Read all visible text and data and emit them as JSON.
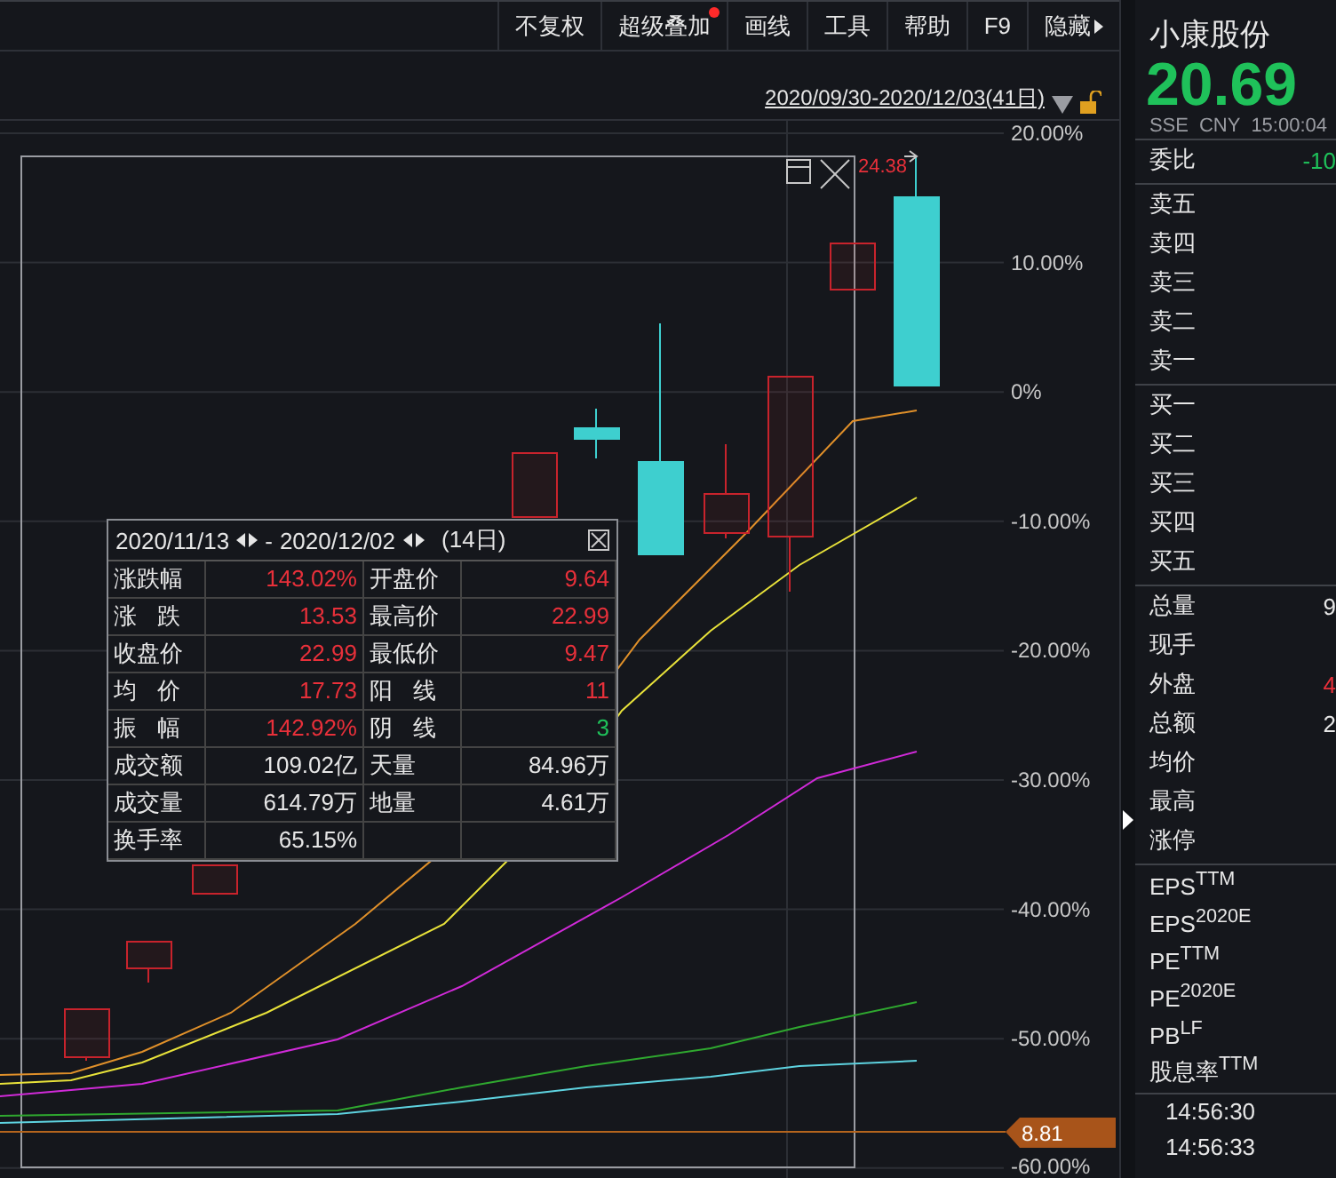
{
  "toolbar": {
    "items": [
      {
        "label": "不复权",
        "dot": false
      },
      {
        "label": "超级叠加",
        "dot": true
      },
      {
        "label": "画线",
        "dot": false
      },
      {
        "label": "工具",
        "dot": false
      },
      {
        "label": "帮助",
        "dot": false
      },
      {
        "label": "F9",
        "dot": false
      },
      {
        "label": "隐藏",
        "kind": "expander",
        "dot": false
      }
    ]
  },
  "range": {
    "label": "2020/09/30-2020/12/03(41日)",
    "locked": false
  },
  "chart": {
    "y_labels": [
      "20.00%",
      "10.00%",
      "0%",
      "-10.00%",
      "-20.00%",
      "-30.00%",
      "-40.00%",
      "-50.00%",
      "-60.00%"
    ],
    "high_label": "24.38",
    "price_tag": "8.81"
  },
  "tooltip": {
    "start": "2020/11/13",
    "separator": "-",
    "end": "2020/12/02",
    "days": "(14日)",
    "rows": [
      {
        "cells": [
          {
            "label": "涨跌幅",
            "value": "143.02%",
            "color": "#e8303a"
          },
          {
            "label": "开盘价",
            "value": "9.64",
            "color": "#e8303a"
          }
        ]
      },
      {
        "cells": [
          {
            "label": "涨 跌",
            "value": "13.53",
            "color": "#e8303a"
          },
          {
            "label": "最高价",
            "value": "22.99",
            "color": "#e8303a"
          }
        ]
      },
      {
        "cells": [
          {
            "label": "收盘价",
            "value": "22.99",
            "color": "#e8303a"
          },
          {
            "label": "最低价",
            "value": "9.47",
            "color": "#e8303a"
          }
        ]
      },
      {
        "cells": [
          {
            "label": "均 价",
            "value": "17.73",
            "color": "#e8303a"
          },
          {
            "label": "阳 线",
            "value": "11",
            "color": "#e8303a"
          }
        ]
      },
      {
        "cells": [
          {
            "label": "振 幅",
            "value": "142.92%",
            "color": "#e8303a"
          },
          {
            "label": "阴 线",
            "value": "3",
            "color": "#1fc15a"
          }
        ]
      },
      {
        "cells": [
          {
            "label": "成交额",
            "value": "109.02亿",
            "color": "#e6e6e6"
          },
          {
            "label": "天量",
            "value": "84.96万",
            "color": "#e6e6e6"
          }
        ]
      },
      {
        "cells": [
          {
            "label": "成交量",
            "value": "614.79万",
            "color": "#e6e6e6"
          },
          {
            "label": "地量",
            "value": "4.61万",
            "color": "#e6e6e6"
          }
        ]
      },
      {
        "cells": [
          {
            "label": "换手率",
            "value": "65.15%",
            "color": "#e6e6e6"
          }
        ]
      }
    ]
  },
  "quote": {
    "name": "小康股份",
    "price": {
      "value": "20.69",
      "color": "#1fc15a"
    },
    "exchange": "SSE",
    "currency": "CNY",
    "time": "15:00:04",
    "sections": [
      {
        "rows": [
          {
            "label": "委比",
            "value": "-10",
            "color": "#1fc15a"
          }
        ]
      },
      {
        "rows": [
          {
            "label": "卖五"
          },
          {
            "label": "卖四"
          },
          {
            "label": "卖三"
          },
          {
            "label": "卖二"
          },
          {
            "label": "卖一"
          }
        ]
      },
      {
        "rows": [
          {
            "label": "买一"
          },
          {
            "label": "买二"
          },
          {
            "label": "买三"
          },
          {
            "label": "买四"
          },
          {
            "label": "买五"
          }
        ]
      },
      {
        "rows": [
          {
            "label": "总量",
            "value": "9",
            "color": "#e6e6e6"
          },
          {
            "label": "现手"
          },
          {
            "label": "外盘",
            "value": "4",
            "color": "#e8303a"
          },
          {
            "label": "总额",
            "value": "2",
            "color": "#e6e6e6"
          },
          {
            "label": "均价"
          },
          {
            "label": "最高"
          },
          {
            "label": "涨停"
          }
        ]
      },
      {
        "rows": [
          {
            "label": "EPS$^{TTM}$"
          },
          {
            "label": "EPS$^{2020E}$"
          },
          {
            "label": "PE$^{TTM}$"
          },
          {
            "label": "PE$^{2020E}$"
          },
          {
            "label": "PB$^{LF}$"
          },
          {
            "label": "股息率$^{TTM}$"
          }
        ]
      }
    ],
    "ticks": [
      "14:56:30",
      "14:56:33"
    ]
  }
}
